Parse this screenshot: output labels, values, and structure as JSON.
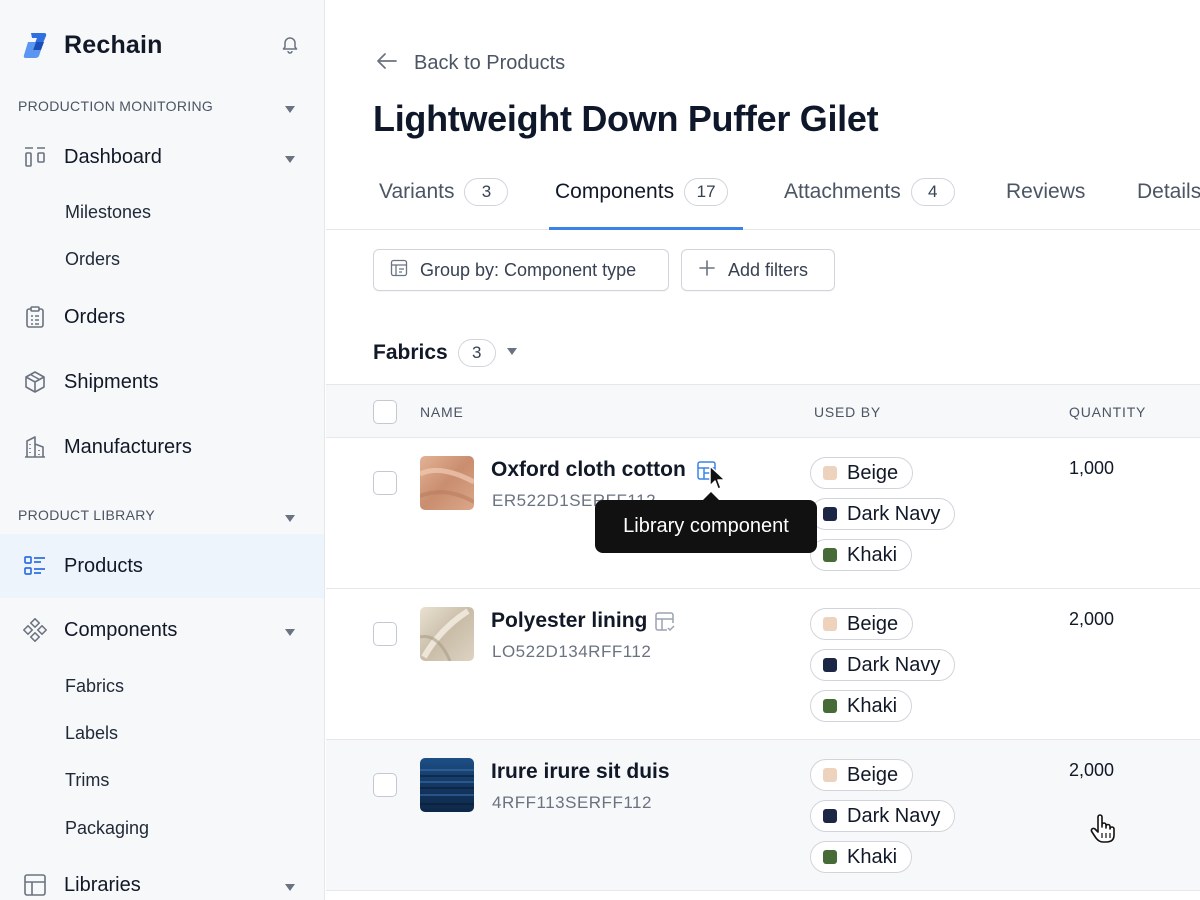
{
  "app": {
    "name": "Rechain",
    "brand_color": "#2f6fe0"
  },
  "sidebar": {
    "section_monitoring": "PRODUCTION MONITORING",
    "section_library": "PRODUCT LIBRARY",
    "dashboard": {
      "label": "Dashboard",
      "icon": "dashboard-icon"
    },
    "dashboard_sub": [
      "Milestones",
      "Orders"
    ],
    "orders": {
      "label": "Orders",
      "icon": "clipboard-icon"
    },
    "shipments": {
      "label": "Shipments",
      "icon": "box-icon"
    },
    "manufacturers": {
      "label": "Manufacturers",
      "icon": "building-icon"
    },
    "products": {
      "label": "Products",
      "icon": "list-icon",
      "active": true
    },
    "components": {
      "label": "Components",
      "icon": "components-icon"
    },
    "components_sub": [
      "Fabrics",
      "Labels",
      "Trims",
      "Packaging"
    ],
    "libraries": {
      "label": "Libraries",
      "icon": "grid-icon"
    }
  },
  "main": {
    "back_label": "Back to Products",
    "title": "Lightweight Down Puffer Gilet",
    "tabs": [
      {
        "label": "Variants",
        "count": "3"
      },
      {
        "label": "Components",
        "count": "17",
        "active": true
      },
      {
        "label": "Attachments",
        "count": "4"
      },
      {
        "label": "Reviews"
      },
      {
        "label": "Details"
      }
    ],
    "group_by_label": "Group by: Component type",
    "add_filters_label": "Add filters",
    "group": {
      "label": "Fabrics",
      "count": "3"
    },
    "columns": {
      "name": "NAME",
      "used_by": "USED BY",
      "quantity": "QUANTITY"
    },
    "colors": {
      "Beige": "#edd3bd",
      "Dark Navy": "#1c2745",
      "Khaki": "#466b36"
    },
    "rows": [
      {
        "name": "Oxford cloth cotton",
        "code": "ER522D1SERFF112",
        "used_by": [
          "Beige",
          "Dark Navy",
          "Khaki"
        ],
        "quantity": "1,000",
        "library_icon_active": true
      },
      {
        "name": "Polyester lining",
        "code": "LO522D134RFF112",
        "used_by": [
          "Beige",
          "Dark Navy",
          "Khaki"
        ],
        "quantity": "2,000",
        "library_icon_active": false
      },
      {
        "name": "Irure irure sit duis",
        "code": "4RFF113SERFF112",
        "used_by": [
          "Beige",
          "Dark Navy",
          "Khaki"
        ],
        "quantity": "2,000"
      }
    ],
    "tooltip": "Library component"
  }
}
